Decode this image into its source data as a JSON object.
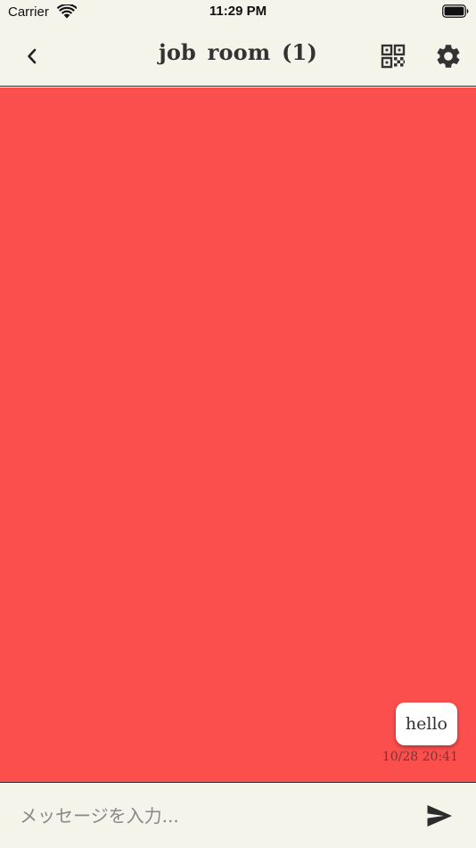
{
  "status_bar": {
    "carrier": "Carrier",
    "time": "11:29 PM",
    "wifi_icon": "wifi-icon",
    "battery_icon": "battery-icon"
  },
  "nav": {
    "back_icon": "chevron-left-icon",
    "title": "job room (1)",
    "qr_icon": "qr-code-icon",
    "settings_icon": "gear-icon"
  },
  "chat": {
    "background_color": "#FB4F4E",
    "messages": [
      {
        "text": "hello",
        "timestamp": "10/28 20:41",
        "side": "right"
      }
    ]
  },
  "input": {
    "placeholder": "メッセージを入力...",
    "value": "",
    "send_icon": "send-icon"
  },
  "colors": {
    "background": "#F5F4EA",
    "accent": "#FB4F4E",
    "text": "#333333"
  }
}
